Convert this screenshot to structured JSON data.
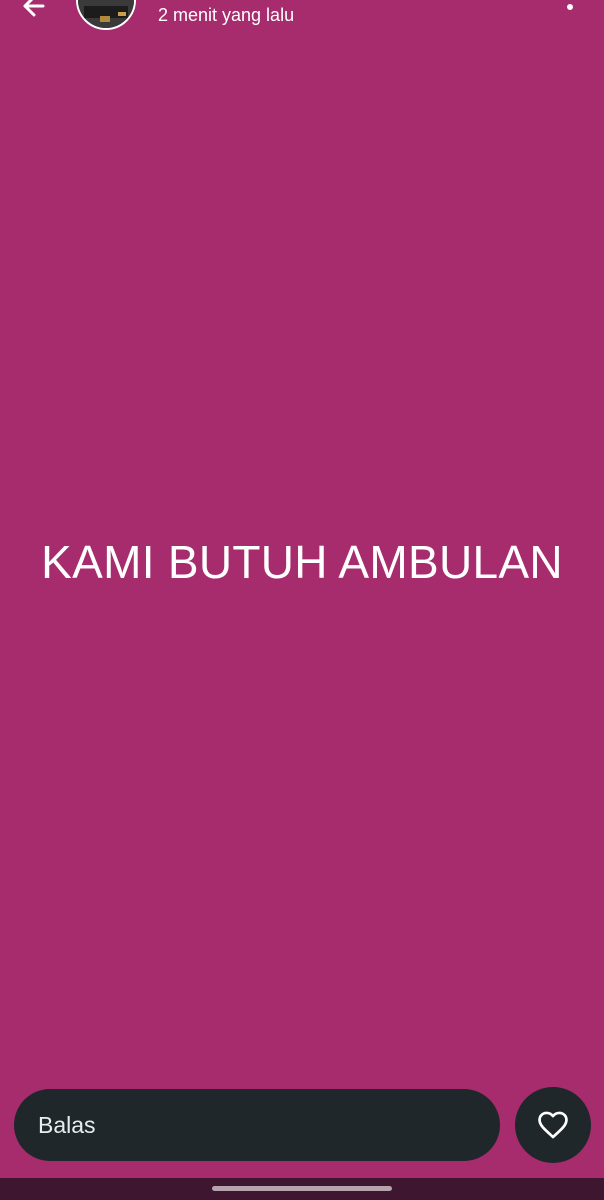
{
  "header": {
    "back_icon": "arrow-back-icon",
    "timestamp": "2 menit yang lalu",
    "menu_icon": "more-vertical-icon"
  },
  "status": {
    "text": "KAMI BUTUH AMBULAN",
    "background_color": "#A62C6E"
  },
  "reply": {
    "placeholder": "Balas",
    "like_icon": "heart-icon"
  },
  "colors": {
    "reply_bar": "#1F272A",
    "nav_bar": "#3E1630"
  }
}
